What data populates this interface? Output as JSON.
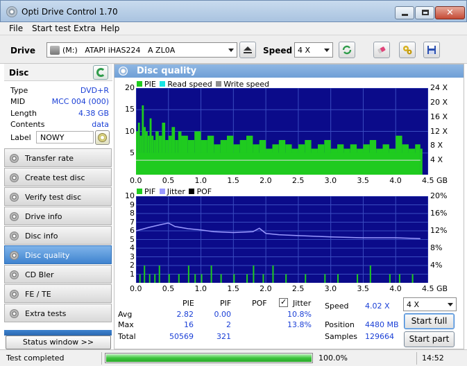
{
  "window": {
    "title": "Opti Drive Control 1.70"
  },
  "menu": [
    "File",
    "Start test",
    "Extra",
    "Help"
  ],
  "toolbar": {
    "drive_label": "Drive",
    "drive_value": "(M:)   ATAPI iHAS224   A ZL0A",
    "speed_label": "Speed",
    "speed_value": "4 X"
  },
  "disc": {
    "heading": "Disc",
    "rows": [
      {
        "key": "Type",
        "value": "DVD+R"
      },
      {
        "key": "MID",
        "value": "MCC 004 (000)"
      },
      {
        "key": "Length",
        "value": "4.38 GB"
      },
      {
        "key": "Contents",
        "value": "data"
      }
    ],
    "label_key": "Label",
    "label_value": "NOWY"
  },
  "nav": [
    {
      "label": "Transfer rate",
      "active": false
    },
    {
      "label": "Create test disc",
      "active": false
    },
    {
      "label": "Verify test disc",
      "active": false
    },
    {
      "label": "Drive info",
      "active": false
    },
    {
      "label": "Disc info",
      "active": false
    },
    {
      "label": "Disc quality",
      "active": true
    },
    {
      "label": "CD Bler",
      "active": false
    },
    {
      "label": "FE / TE",
      "active": false
    },
    {
      "label": "Extra tests",
      "active": false
    }
  ],
  "status_window_button": "Status window >>",
  "panel": {
    "title": "Disc quality"
  },
  "chart_data": [
    {
      "type": "bar",
      "legend": [
        "PIE",
        "Read speed",
        "Write speed"
      ],
      "colors": {
        "PIE": "#1fcb1f",
        "Read speed": "#19e3e3",
        "Write speed": "#8e8e8e",
        "background": "#0b0b8a",
        "grid": "#3a4cc0",
        "speed_line": "#e0e0e0"
      },
      "x_ticks": [
        "0.0",
        "0.5",
        "1.0",
        "1.5",
        "2.0",
        "2.5",
        "3.0",
        "3.5",
        "4.0",
        "4.5 GB"
      ],
      "xlim": [
        0,
        4.5
      ],
      "y_left_ticks": [
        "20",
        "15",
        "10",
        "5"
      ],
      "ylim_left": [
        0,
        20
      ],
      "y_right_ticks": [
        "24 X",
        "20 X",
        "16 X",
        "12 X",
        "8 X",
        "4 X"
      ],
      "ylim_right": [
        0,
        24
      ],
      "read_speed_x": 4.02,
      "series": [
        {
          "name": "PIE",
          "x": [
            0.0,
            0.03,
            0.06,
            0.09,
            0.12,
            0.15,
            0.18,
            0.21,
            0.24,
            0.27,
            0.3,
            0.35,
            0.4,
            0.45,
            0.5,
            0.55,
            0.6,
            0.65,
            0.7,
            0.8,
            0.9,
            1.0,
            1.1,
            1.2,
            1.3,
            1.4,
            1.5,
            1.6,
            1.7,
            1.8,
            1.9,
            2.0,
            2.1,
            2.2,
            2.3,
            2.4,
            2.5,
            2.6,
            2.7,
            2.8,
            2.9,
            3.0,
            3.1,
            3.2,
            3.3,
            3.4,
            3.5,
            3.6,
            3.7,
            3.8,
            3.9,
            4.0,
            4.1,
            4.2,
            4.3,
            4.38
          ],
          "values": [
            10,
            12,
            9,
            16,
            11,
            10,
            9,
            13,
            9,
            8,
            10,
            9,
            12,
            8,
            9,
            11,
            8,
            10,
            9,
            8,
            10,
            8,
            9,
            7,
            8,
            9,
            7,
            8,
            9,
            7,
            8,
            6,
            7,
            8,
            7,
            6,
            7,
            8,
            6,
            7,
            8,
            6,
            7,
            6,
            7,
            6,
            7,
            8,
            6,
            7,
            6,
            9,
            7,
            6,
            7,
            6
          ]
        },
        {
          "name": "Read speed",
          "x": [
            0.0,
            4.38
          ],
          "values": [
            4.0,
            4.0
          ]
        }
      ]
    },
    {
      "type": "bar",
      "legend": [
        "PIF",
        "Jitter",
        "POF"
      ],
      "colors": {
        "PIF": "#1fcb1f",
        "Jitter": "#9a9aff",
        "POF": "#000000",
        "background": "#0b0b8a",
        "grid": "#3a4cc0"
      },
      "x_ticks": [
        "0.0",
        "0.5",
        "1.0",
        "1.5",
        "2.0",
        "2.5",
        "3.0",
        "3.5",
        "4.0",
        "4.5 GB"
      ],
      "xlim": [
        0,
        4.5
      ],
      "y_left_ticks": [
        "10",
        "9",
        "8",
        "7",
        "6",
        "5",
        "4",
        "3",
        "2",
        "1"
      ],
      "ylim_left": [
        0,
        10
      ],
      "y_right_ticks": [
        "20%",
        "16%",
        "12%",
        "8%",
        "4%"
      ],
      "ylim_right": [
        0,
        20
      ],
      "series": [
        {
          "name": "PIF",
          "x": [
            0.05,
            0.12,
            0.2,
            0.28,
            0.35,
            0.5,
            0.65,
            0.8,
            0.9,
            1.0,
            1.15,
            1.3,
            1.5,
            1.7,
            1.8,
            1.95,
            2.1,
            2.3,
            2.6,
            2.9,
            3.1,
            3.4,
            3.6,
            3.9,
            4.05,
            4.25
          ],
          "values": [
            1,
            2,
            1,
            1,
            2,
            1,
            1,
            2,
            1,
            1,
            2,
            1,
            1,
            1,
            2,
            1,
            2,
            1,
            1,
            1,
            1,
            1,
            2,
            1,
            1,
            1
          ]
        },
        {
          "name": "Jitter",
          "x": [
            0.0,
            0.2,
            0.4,
            0.5,
            0.6,
            0.8,
            1.0,
            1.2,
            1.5,
            1.8,
            1.9,
            2.0,
            2.2,
            2.5,
            3.0,
            3.5,
            4.0,
            4.38
          ],
          "values": [
            12.0,
            12.8,
            13.5,
            13.8,
            13.0,
            12.5,
            12.2,
            11.8,
            11.6,
            11.8,
            12.6,
            11.4,
            11.1,
            10.9,
            10.6,
            10.4,
            10.4,
            10.2
          ]
        }
      ]
    }
  ],
  "stats": {
    "headers": {
      "pie": "PIE",
      "pif": "PIF",
      "pof": "POF",
      "jitter": "Jitter"
    },
    "rows": [
      {
        "label": "Avg",
        "pie": "2.82",
        "pif": "0.00",
        "jitter": "10.8%"
      },
      {
        "label": "Max",
        "pie": "16",
        "pif": "2",
        "jitter": "13.8%"
      },
      {
        "label": "Total",
        "pie": "50569",
        "pif": "321",
        "jitter": ""
      }
    ],
    "speed_label": "Speed",
    "speed_value": "4.02 X",
    "position_label": "Position",
    "position_value": "4480 MB",
    "samples_label": "Samples",
    "samples_value": "129664",
    "speed_select": "4 X",
    "start_full": "Start full",
    "start_part": "Start part"
  },
  "statusbar": {
    "text": "Test completed",
    "progress_percent": 100,
    "progress_text": "100.0%",
    "time": "14:52"
  }
}
